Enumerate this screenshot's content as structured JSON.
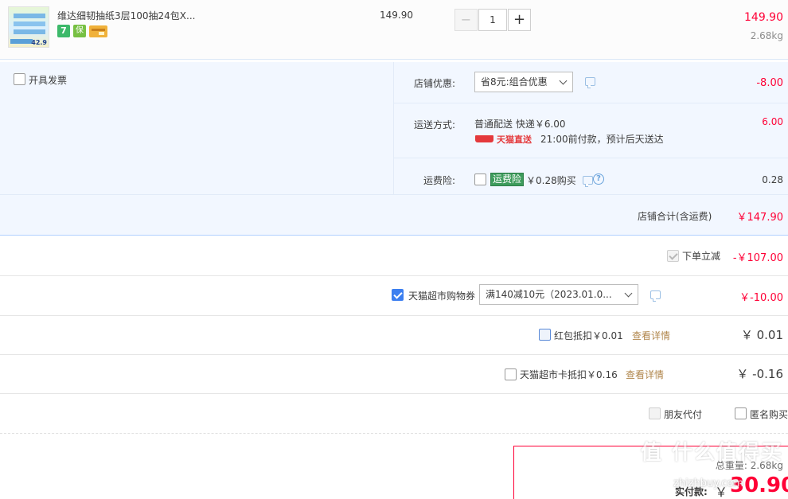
{
  "item": {
    "title": "维达细韧抽纸3层100抽24包X...",
    "thumb_price": "42.9",
    "badges": [
      "7",
      "保",
      "卡"
    ],
    "unit_price": "149.90",
    "qty_minus": "−",
    "quantity": "1",
    "qty_plus": "+",
    "subtotal": "149.90",
    "weight": "2.68kg"
  },
  "shop": {
    "invoice_label": "开具发票",
    "discount_label": "店铺优惠:",
    "discount_select": "省8元:组合优惠",
    "discount_value": "-8.00",
    "shipping_label": "运送方式:",
    "shipping_method": "普通配送 快递￥6.00",
    "tmall_delivery_logo": "天猫直送",
    "shipping_note": "21:00前付款，预计后天送达",
    "shipping_value": "6.00",
    "insurance_label": "运费险:",
    "insurance_badge": "运费险",
    "insurance_text": "￥0.28购买",
    "insurance_value": "0.28",
    "total_label": "店铺合计(含运费)",
    "total_value": "￥147.90"
  },
  "order": {
    "instant_reduce_label": "下单立减",
    "instant_reduce_value": "-￥107.00",
    "coupon_label": "天猫超市购物券",
    "coupon_select": "满140减10元（2023.01.0...",
    "coupon_value": "￥-10.00",
    "redpacket_label": "红包抵扣￥0.01",
    "redpacket_link": "查看详情",
    "redpacket_value": "￥ 0.01",
    "card_label": "天猫超市卡抵扣￥0.16",
    "card_link": "查看详情",
    "card_value": "￥ -0.16",
    "friend_pay_label": "朋友代付",
    "anonymous_label": "匿名购买",
    "weight_label": "总重量: 2.68kg",
    "pay_label": "实付款:",
    "pay_currency": "￥",
    "pay_value": "30.90"
  },
  "watermark": "值 什么值得买",
  "watermark_url": "zhizhbuy.com",
  "colors": {
    "accent_red": "#ff0036",
    "info_bg": "#f2f7ff",
    "border_blue": "#b2d1ff",
    "checkbox_blue": "#3c7ff0",
    "link_brown": "#b0864b"
  }
}
